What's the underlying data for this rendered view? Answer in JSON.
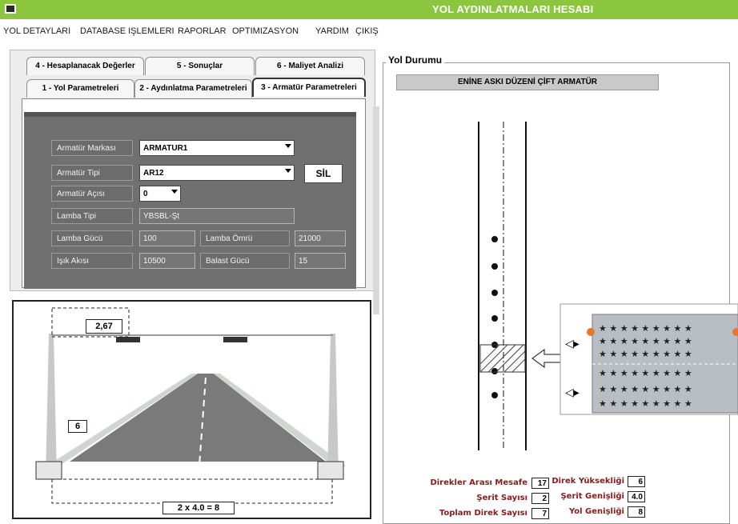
{
  "window": {
    "title": "YOL AYDINLATMALARI HESABI"
  },
  "menu": [
    "YOL DETAYLARI",
    "DATABASE IŞLEMLERI",
    "RAPORLAR",
    "OPTIMIZASYON",
    "YARDIM",
    "ÇIKIŞ"
  ],
  "tabs_top": [
    "4 - Hesaplanacak Değerler",
    "5 - Sonuçlar",
    "6 - Maliyet Analizi"
  ],
  "tabs_bottom": [
    "1 - Yol Parametreleri",
    "2 - Aydınlatma Parametreleri",
    "3 - Armatür Parametreleri"
  ],
  "form": {
    "marka_label": "Armatür Markası",
    "marka_value": "ARMATUR1",
    "tip_label": "Armatür Tipi",
    "tip_value": "AR12",
    "aci_label": "Armatür Açısı",
    "aci_value": "0",
    "lamba_tipi_label": "Lamba Tipi",
    "lamba_tipi_value": "YBSBL-Şt",
    "lamba_gucu_label": "Lamba Gücü",
    "lamba_gucu_value": "100",
    "lamba_omru_label": "Lamba Ömrü",
    "lamba_omru_value": "21000",
    "isik_akisi_label": "Işık Akısı",
    "isik_akisi_value": "10500",
    "balast_label": "Balast Gücü",
    "balast_value": "15",
    "sil_label": "SİL"
  },
  "cross_section": {
    "top_dim": "2,67",
    "pole_height": "6",
    "bottom_dim": "2 x 4.0 = 8"
  },
  "road_status": {
    "caption": "Yol Durumu",
    "header": "ENİNE ASKI DÜZENİ ÇİFT ARMATÜR",
    "direkler_arasi_label": "Direkler Arası Mesafe",
    "direkler_arasi_value": "17",
    "serit_sayisi_label": "Şerit Sayısı",
    "serit_sayisi_value": "2",
    "toplam_direk_label": "Toplam Direk Sayısı",
    "toplam_direk_value": "7",
    "direk_yuksekligi_label": "Direk Yüksekliği",
    "direk_yuksekligi_value": "6",
    "serit_genisligi_label": "Şerit Genişliği",
    "serit_genisligi_value": "4.0",
    "yol_genisligi_label": "Yol Genişliği",
    "yol_genisligi_value": "8"
  },
  "colors": {
    "titlebar": "#8cc63f",
    "label_red": "#8b1a1a",
    "panel_gray": "#707070"
  }
}
